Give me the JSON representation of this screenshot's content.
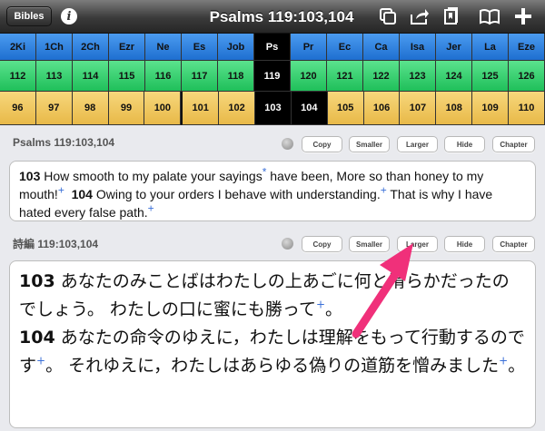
{
  "topbar": {
    "bibles_label": "Bibles",
    "title": "Psalms 119:103,104",
    "icons": [
      "info-icon",
      "copy-windows-icon",
      "share-icon",
      "bookmark-books-icon",
      "open-book-icon",
      "add-icon"
    ]
  },
  "books": [
    {
      "label": "2Ki",
      "selected": false
    },
    {
      "label": "1Ch",
      "selected": false
    },
    {
      "label": "2Ch",
      "selected": false
    },
    {
      "label": "Ezr",
      "selected": false
    },
    {
      "label": "Ne",
      "selected": false
    },
    {
      "label": "Es",
      "selected": false
    },
    {
      "label": "Job",
      "selected": false
    },
    {
      "label": "Ps",
      "selected": true
    },
    {
      "label": "Pr",
      "selected": false
    },
    {
      "label": "Ec",
      "selected": false
    },
    {
      "label": "Ca",
      "selected": false
    },
    {
      "label": "Isa",
      "selected": false
    },
    {
      "label": "Jer",
      "selected": false
    },
    {
      "label": "La",
      "selected": false
    },
    {
      "label": "Eze",
      "selected": false
    }
  ],
  "chapters": [
    {
      "label": "112",
      "selected": false
    },
    {
      "label": "113",
      "selected": false
    },
    {
      "label": "114",
      "selected": false
    },
    {
      "label": "115",
      "selected": false
    },
    {
      "label": "116",
      "selected": false
    },
    {
      "label": "117",
      "selected": false
    },
    {
      "label": "118",
      "selected": false
    },
    {
      "label": "119",
      "selected": true
    },
    {
      "label": "120",
      "selected": false
    },
    {
      "label": "121",
      "selected": false
    },
    {
      "label": "122",
      "selected": false
    },
    {
      "label": "123",
      "selected": false
    },
    {
      "label": "124",
      "selected": false
    },
    {
      "label": "125",
      "selected": false
    },
    {
      "label": "126",
      "selected": false
    }
  ],
  "verses": [
    {
      "label": "96",
      "selected": false
    },
    {
      "label": "97",
      "selected": false
    },
    {
      "label": "98",
      "selected": false
    },
    {
      "label": "99",
      "selected": false
    },
    {
      "label": "100",
      "selected": false
    },
    {
      "label": "101",
      "selected": false
    },
    {
      "label": "102",
      "selected": false
    },
    {
      "label": "103",
      "selected": true
    },
    {
      "label": "104",
      "selected": true
    },
    {
      "label": "105",
      "selected": false
    },
    {
      "label": "106",
      "selected": false
    },
    {
      "label": "107",
      "selected": false
    },
    {
      "label": "108",
      "selected": false
    },
    {
      "label": "109",
      "selected": false
    },
    {
      "label": "110",
      "selected": false
    }
  ],
  "section1": {
    "title": "Psalms 119:103,104",
    "buttons": {
      "copy": "Copy",
      "smaller": "Smaller",
      "larger": "Larger",
      "hide": "Hide",
      "chapter": "Chapter"
    },
    "v1_num": "103",
    "v1_text_a": " How smooth to my palate your sayings",
    "v1_mark": "*",
    "v1_text_b": "  have been, More so than honey to my mouth!",
    "v1_plus": "+",
    "v2_num": "104",
    "v2_text_a": " Owing to your orders I behave with understanding.",
    "v2_plus_a": "+",
    "v2_text_b": "  That is why I have hated every false path.",
    "v2_plus_b": "+"
  },
  "section2": {
    "title": "詩編 119:103,104",
    "buttons": {
      "copy": "Copy",
      "smaller": "Smaller",
      "larger": "Larger",
      "hide": "Hide",
      "chapter": "Chapter"
    },
    "v1_num": "103",
    "v1_text": " あなたのみことばはわたしの上あごに何と滑らかだったのでしょう。 わたしの口に蜜にも勝って",
    "v1_plus": "+",
    "v1_end": "。",
    "v2_num": "104",
    "v2_text_a": " あなたの命令のゆえに，わたしは理解をもって行動するのです",
    "v2_plus_a": "+",
    "v2_text_b": "。 それゆえに，わたしはあらゆる偽りの道筋を憎みました",
    "v2_plus_b": "+",
    "v2_end": "。"
  },
  "colors": {
    "books_row": "#2a7fe0",
    "chapters_row": "#2fd06a",
    "verses_row": "#efc45c",
    "selected": "#000000",
    "annotation_arrow": "#f0307a"
  }
}
